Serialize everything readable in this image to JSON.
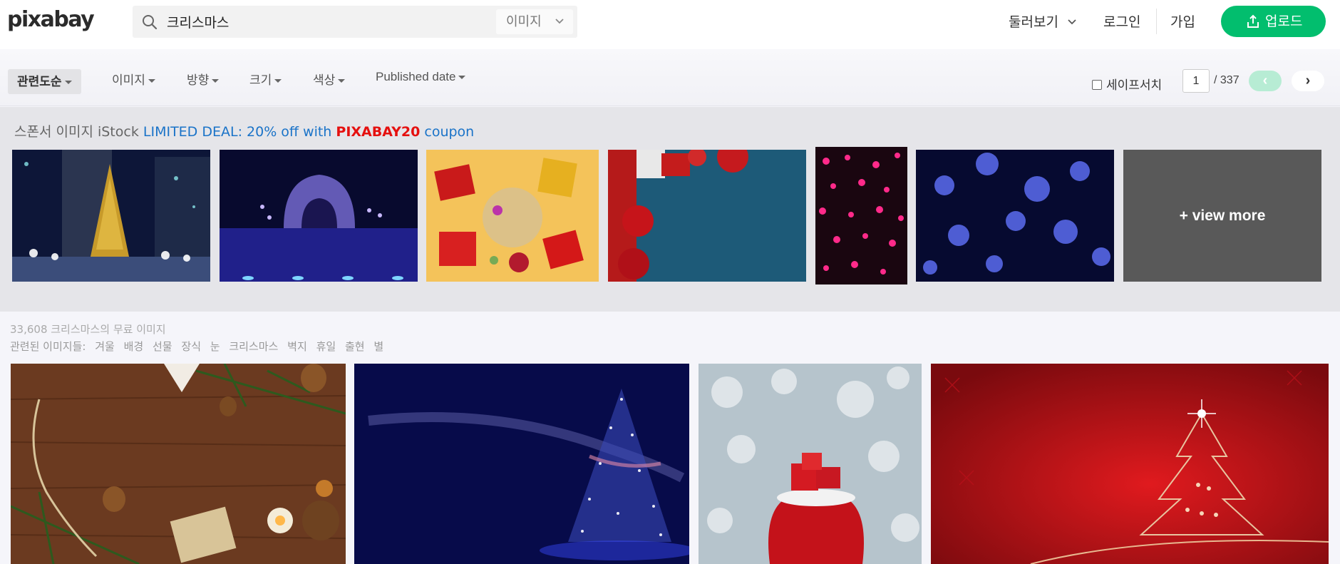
{
  "header": {
    "logo": "pixabay",
    "search": {
      "value": "크리스마스",
      "type_label": "이미지"
    },
    "nav": {
      "explore": "둘러보기",
      "login": "로그인",
      "join": "가입",
      "upload": "업로드"
    }
  },
  "filters": {
    "items": [
      {
        "label": "관련도순"
      },
      {
        "label": "이미지"
      },
      {
        "label": "방향"
      },
      {
        "label": "크기"
      },
      {
        "label": "색상"
      },
      {
        "label": "Published date"
      }
    ],
    "safesearch_label": "세이프서치",
    "pagination": {
      "current": "1",
      "total": "/ 337",
      "prev": "‹",
      "next": "›"
    }
  },
  "sponsored": {
    "label": "스폰서 이미지",
    "provider": "iStock",
    "deal_text": "LIMITED DEAL: 20% off with",
    "coupon": "PIXABAY20",
    "coupon_suffix": "coupon",
    "view_more": "+ view more"
  },
  "results": {
    "count_text": "33,608 크리스마스의 무료 이미지",
    "related_label": "관련된 이미지들:",
    "related_tags": [
      "겨울",
      "배경",
      "선물",
      "장식",
      "눈",
      "크리스마스",
      "벽지",
      "휴일",
      "출현",
      "별"
    ]
  },
  "colors": {
    "brand_green": "#02be6e",
    "link_blue": "#1a73c8",
    "coupon_red": "#e5100f"
  }
}
